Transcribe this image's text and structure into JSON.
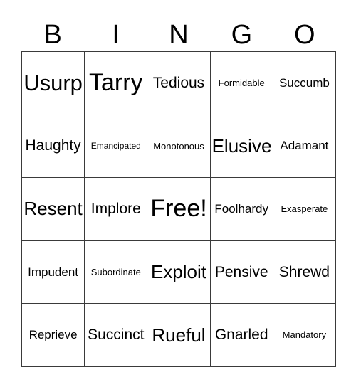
{
  "card": {
    "title_letters": [
      "B",
      "I",
      "N",
      "G",
      "O"
    ],
    "free_space_label": "Free!",
    "grid": {
      "columns": 5,
      "rows": 5,
      "cells": [
        [
          {
            "text": "Usurp",
            "size": "fs-lg"
          },
          {
            "text": "Tarry",
            "size": "fs-xl"
          },
          {
            "text": "Tedious",
            "size": "fs-md"
          },
          {
            "text": "Formidable",
            "size": "fs-xs"
          },
          {
            "text": "Succumb",
            "size": "fs-sm"
          }
        ],
        [
          {
            "text": "Haughty",
            "size": "fs-md"
          },
          {
            "text": "Emancipated",
            "size": "fs-xxs"
          },
          {
            "text": "Monotonous",
            "size": "fs-xs"
          },
          {
            "text": "Elusive",
            "size": "fs-ml"
          },
          {
            "text": "Adamant",
            "size": "fs-sm"
          }
        ],
        [
          {
            "text": "Resent",
            "size": "fs-ml"
          },
          {
            "text": "Implore",
            "size": "fs-md"
          },
          {
            "text": "Free!",
            "size": "fs-xl"
          },
          {
            "text": "Foolhardy",
            "size": "fs-sm"
          },
          {
            "text": "Exasperate",
            "size": "fs-xs"
          }
        ],
        [
          {
            "text": "Impudent",
            "size": "fs-sm"
          },
          {
            "text": "Subordinate",
            "size": "fs-xs"
          },
          {
            "text": "Exploit",
            "size": "fs-ml"
          },
          {
            "text": "Pensive",
            "size": "fs-md"
          },
          {
            "text": "Shrewd",
            "size": "fs-md"
          }
        ],
        [
          {
            "text": "Reprieve",
            "size": "fs-sm"
          },
          {
            "text": "Succinct",
            "size": "fs-md"
          },
          {
            "text": "Rueful",
            "size": "fs-ml"
          },
          {
            "text": "Gnarled",
            "size": "fs-md"
          },
          {
            "text": "Mandatory",
            "size": "fs-xs"
          }
        ]
      ]
    },
    "colors": {
      "background": "#ffffff",
      "text": "#000000",
      "border": "#3a3a3a"
    }
  }
}
